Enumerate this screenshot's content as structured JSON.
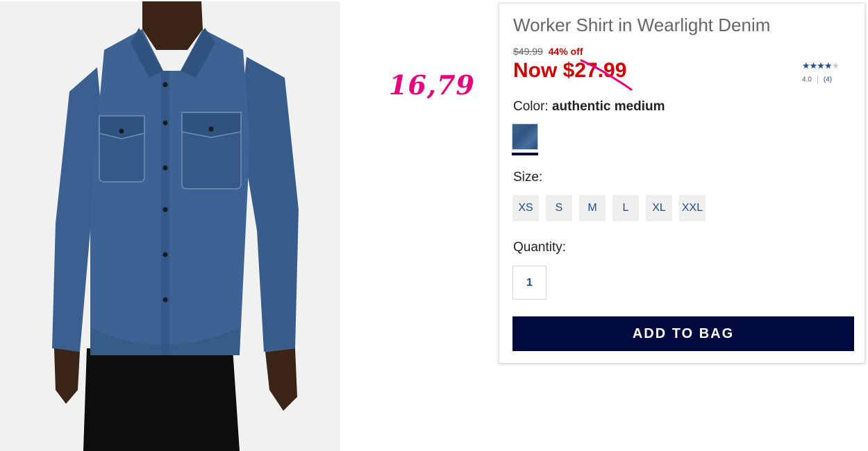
{
  "annotation": {
    "handwritten_price": "16,79"
  },
  "product": {
    "title": "Worker Shirt in Wearlight Denim",
    "original_price": "$49.99",
    "discount": "44% off",
    "sale_price": "Now $27.99",
    "rating_value": "4.0",
    "rating_count": "(4)",
    "stars_filled": 4,
    "stars_total": 5
  },
  "color": {
    "label": "Color:",
    "value": "authentic medium",
    "swatch_color": "#355b88"
  },
  "size": {
    "label": "Size:",
    "options": [
      "XS",
      "S",
      "M",
      "L",
      "XL",
      "XXL"
    ]
  },
  "quantity": {
    "label": "Quantity:",
    "value": "1"
  },
  "actions": {
    "add_to_bag": "ADD TO BAG"
  },
  "colors": {
    "accent_navy": "#000a3d",
    "sale_red": "#d10000",
    "link_blue": "#1f4f8a",
    "annotation_pink": "#e6007e"
  }
}
